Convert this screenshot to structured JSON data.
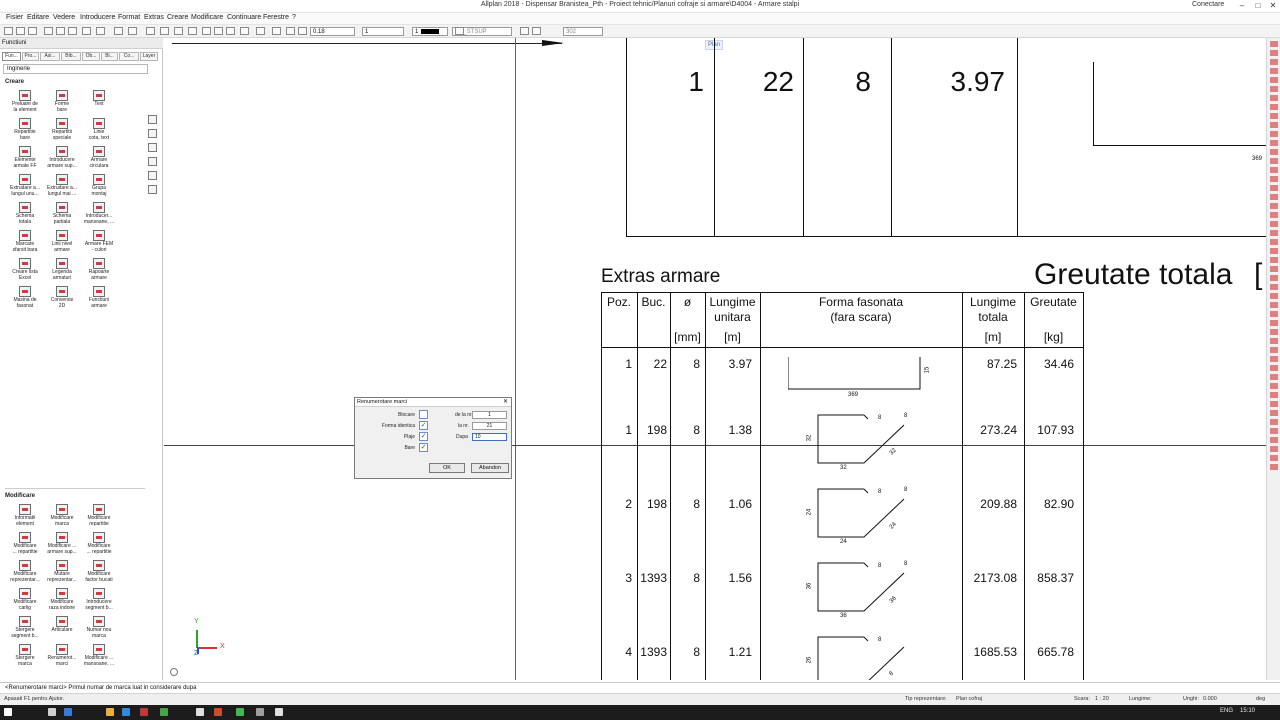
{
  "window": {
    "title": "Allplan 2018 - Dispensar Branistea_Pth - Proiect tehnic/Planuri cofraje si armare\\D4004 - Armare stalpi",
    "connect_label": "Conectare",
    "minimize": "–",
    "maximize": "□",
    "close": "✕"
  },
  "menu": [
    "Fisier",
    "Editare",
    "Vedere",
    "Introducere",
    "Format",
    "Extras",
    "Creare",
    "Modificare",
    "Continuare",
    "Ferestre",
    "?"
  ],
  "toolbar": {
    "pen_thickness": "0.18",
    "line_type": "1",
    "color": "1",
    "layer": "AR_STSUP",
    "scale": "302"
  },
  "left_panel": {
    "header": "Functiuni",
    "tabs": [
      "Fun...",
      "Pro...",
      "Asi...",
      "Bib...",
      "Ob...",
      "Bi...",
      "Co...",
      "Layer"
    ],
    "filter_value": "Inginerie",
    "section_create": "Creare",
    "create_items": [
      "Preluare de\nla element",
      "Forme\nbare",
      "Text",
      "Repartitie\nbare",
      "Repartitii\nspeciale",
      "Linie\ncota, text",
      "Elemente\narmate FF",
      "Introducere\narmare sup...",
      "Armare\ncirculara",
      "Extrudare a...\nlungul unu...",
      "Extrudare a...\nlungul mai ...",
      "Grupa\nmontaj",
      "Schema\ntotala",
      "Schema\npartiala",
      "Introducer...\nmansoane, ...",
      "Marcare\nsfarsit bara",
      "Linii nivel\narmare",
      "Armare FEM\n- culori",
      "Creare lista\nExcel",
      "Legenda\narmaturi",
      "Rapoarte\narmare",
      "Masina de\nfasonat",
      "Conversie\n2D",
      "Functiuni\narmare"
    ],
    "section_modify": "Modificare",
    "modify_items": [
      "Informatii\nelement",
      "Modificare\nmarca",
      "Modificare\nrepartitie",
      "Modificare\n... repartitie",
      "Modificare ...\narmare sup...",
      "Modificare\n... repartitie",
      "Modificare\nreprezentar...",
      "Mutare\nreprezentar...",
      "Modificare\nfactor bucati",
      "Modificare\ncarlig",
      "Modificare\nraza indoire",
      "Introducere\nsegment b...",
      "Stergere\nsegment b...",
      "Articulare",
      "Numar nou\nmarca",
      "Stergere\nmarca",
      "Renumerot...\nmarci",
      "Modificare ...\nmansoane, ..."
    ]
  },
  "canvas": {
    "plan_tag": "Plan",
    "top_row": [
      "1",
      "22",
      "8",
      "3.97"
    ],
    "top_dim": "369",
    "section_title": "Extras armare",
    "big_title": "Greutate totala",
    "big_bracket": "[",
    "headers": {
      "poz": "Poz.",
      "buc": "Buc.",
      "diam": "ø",
      "diam_unit": "[mm]",
      "len1": "Lungime",
      "len2": "unitara",
      "len_unit": "[m]",
      "shape1": "Forma fasonata",
      "shape2": "(fara scara)",
      "tot1": "Lungime",
      "tot2": "totala",
      "tot_unit": "[m]",
      "wt": "Greutate",
      "wt_unit": "[kg]"
    },
    "rows": [
      {
        "poz": "1",
        "buc": "22",
        "diam": "8",
        "len": "3.97",
        "total": "87.25",
        "weight": "34.46",
        "dims": [
          "15",
          "369"
        ]
      },
      {
        "poz": "1",
        "buc": "198",
        "diam": "8",
        "len": "1.38",
        "total": "273.24",
        "weight": "107.93",
        "dims": [
          "32",
          "32",
          "8",
          "8",
          "32"
        ]
      },
      {
        "poz": "2",
        "buc": "198",
        "diam": "8",
        "len": "1.06",
        "total": "209.88",
        "weight": "82.90",
        "dims": [
          "24",
          "24",
          "8",
          "8",
          "24"
        ]
      },
      {
        "poz": "3",
        "buc": "1393",
        "diam": "8",
        "len": "1.56",
        "total": "2173.08",
        "weight": "858.37",
        "dims": [
          "36",
          "36",
          "8",
          "8",
          "36"
        ]
      },
      {
        "poz": "4",
        "buc": "1393",
        "diam": "8",
        "len": "1.21",
        "total": "1685.53",
        "weight": "665.78",
        "dims": [
          "26",
          "8",
          "8"
        ]
      }
    ],
    "axis": {
      "x": "X",
      "y": "Y",
      "z": "Z"
    }
  },
  "dialog": {
    "title": "Renumerotare marci",
    "labels": {
      "lock": "Blocare",
      "same_shape": "Forma identica",
      "plane": "Plaje",
      "bars": "Bare",
      "from": "de la nr.",
      "to": "la nr.",
      "after": "Dupa"
    },
    "values": {
      "from": "1",
      "to": "21",
      "after": "10"
    },
    "ok": "OK",
    "cancel": "Abandon",
    "close": "✕"
  },
  "status_line": "<Renumerotare marci> Primul numar de marca luat in considerare dupa",
  "status_bar": {
    "help": "Apasati F1 pentru Ajutor.",
    "rep_label": "Tip reprezentare:",
    "rep_value": "Plan cofraj",
    "scale_label": "Scara:",
    "scale_value": "1 : 20",
    "len_label": "Lungime:",
    "angle_label": "Unghi:",
    "angle_value": "0.000",
    "deg": "deg"
  },
  "taskbar": {
    "lang": "ENG",
    "time": "15:10"
  },
  "colors": {
    "accent": "#1a73e8",
    "red_icon": "#d43a3a",
    "axis_x": "#d93030",
    "axis_y": "#2aa52a",
    "axis_z": "#2b4fc9"
  }
}
